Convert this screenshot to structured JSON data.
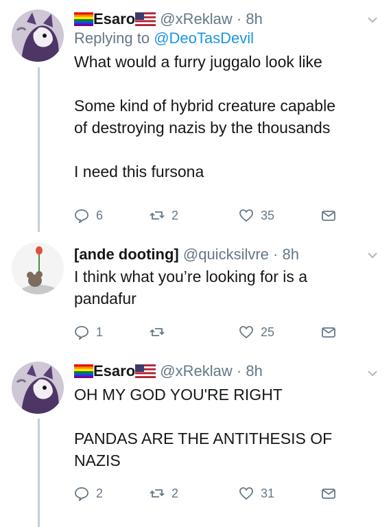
{
  "tweets": [
    {
      "name": "Esaro",
      "handle": "@xReklaw",
      "dot": "·",
      "time": "8h",
      "reply_prefix": "Replying to",
      "reply_mention": "@DeoTasDevil",
      "text": "What would a furry juggalo look like\n\nSome kind of hybrid creature capable\nof destroying nazis by the thousands\n\nI need this fursona",
      "replies": "6",
      "retweets": "2",
      "likes": "35"
    },
    {
      "name": "[ande dooting]",
      "handle": "@quicksilvre",
      "dot": "·",
      "time": "8h",
      "text": "I think what you’re looking for is a\npandafur",
      "replies": "1",
      "retweets": "",
      "likes": "25"
    },
    {
      "name": "Esaro",
      "handle": "@xReklaw",
      "dot": "·",
      "time": "8h",
      "text": "OH MY GOD YOU'RE RIGHT\n\nPANDAS ARE THE ANTITHESIS OF\nNAZIS",
      "replies": "2",
      "retweets": "2",
      "likes": "31"
    }
  ],
  "icons": {
    "reply": "reply-icon",
    "retweet": "retweet-icon",
    "like": "heart-icon",
    "dm": "envelope-icon",
    "menu": "chevron-down-icon"
  },
  "colors": {
    "text": "#14171a",
    "secondary": "#657786",
    "link": "#1b95e0",
    "thread_line": "#c4cfd6"
  }
}
